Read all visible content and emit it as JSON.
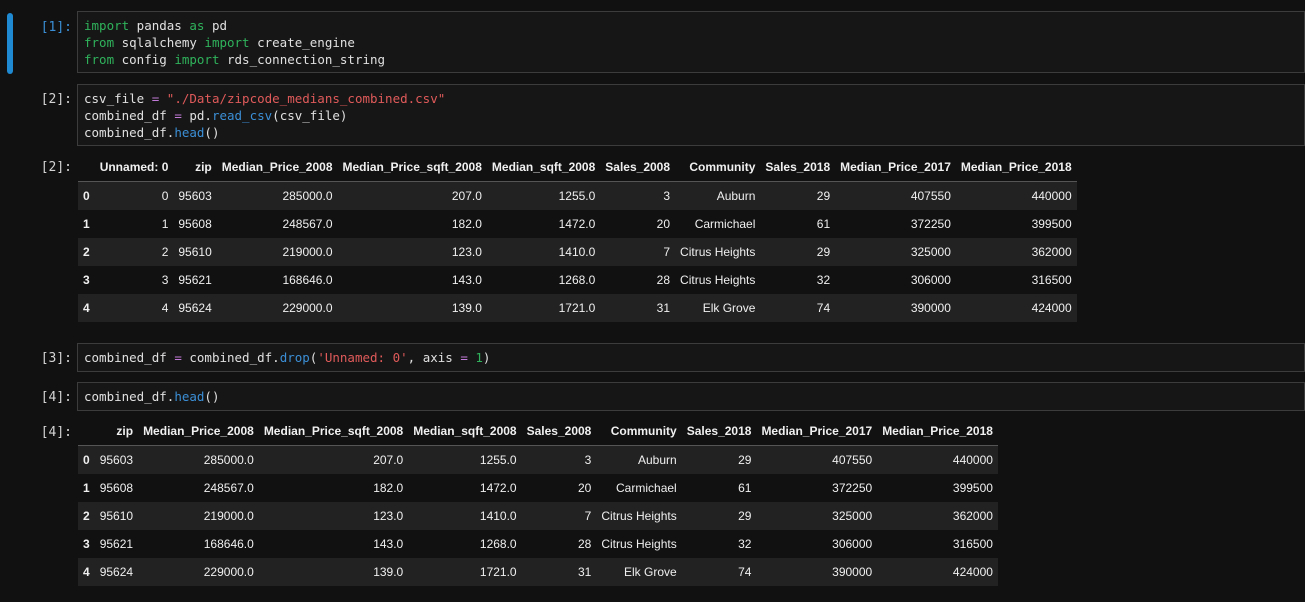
{
  "cells": [
    {
      "prompt": "[1]:",
      "lines": [
        [
          [
            "kw",
            "import"
          ],
          [
            "t",
            " pandas "
          ],
          [
            "kw",
            "as"
          ],
          [
            "t",
            " pd"
          ]
        ],
        [
          [
            "kw",
            "from"
          ],
          [
            "t",
            " sqlalchemy "
          ],
          [
            "kw",
            "import"
          ],
          [
            "t",
            " create_engine"
          ]
        ],
        [
          [
            "kw",
            "from"
          ],
          [
            "t",
            " config "
          ],
          [
            "kw",
            "import"
          ],
          [
            "t",
            " rds_connection_string"
          ]
        ]
      ]
    },
    {
      "prompt": "[2]:",
      "lines": [
        [
          [
            "t",
            "csv_file "
          ],
          [
            "op",
            "="
          ],
          [
            "t",
            " "
          ],
          [
            "str",
            "\"./Data/zipcode_medians_combined.csv\""
          ]
        ],
        [
          [
            "t",
            "combined_df "
          ],
          [
            "op",
            "="
          ],
          [
            "t",
            " pd."
          ],
          [
            "fn",
            "read_csv"
          ],
          [
            "t",
            "(csv_file)"
          ]
        ],
        [
          [
            "t",
            "combined_df."
          ],
          [
            "fn",
            "head"
          ],
          [
            "t",
            "()"
          ]
        ]
      ]
    },
    {
      "prompt": "[3]:",
      "lines": [
        [
          [
            "t",
            "combined_df "
          ],
          [
            "op",
            "="
          ],
          [
            "t",
            " combined_df."
          ],
          [
            "fn",
            "drop"
          ],
          [
            "t",
            "("
          ],
          [
            "str",
            "'Unnamed: 0'"
          ],
          [
            "t",
            ", axis "
          ],
          [
            "op",
            "="
          ],
          [
            "t",
            " "
          ],
          [
            "num",
            "1"
          ],
          [
            "t",
            ")"
          ]
        ]
      ]
    },
    {
      "prompt": "[4]:",
      "lines": [
        [
          [
            "t",
            "combined_df."
          ],
          [
            "fn",
            "head"
          ],
          [
            "t",
            "()"
          ]
        ]
      ]
    }
  ],
  "outputs": [
    {
      "prompt": "[2]:",
      "columns": [
        "",
        "Unnamed: 0",
        "zip",
        "Median_Price_2008",
        "Median_Price_sqft_2008",
        "Median_sqft_2008",
        "Sales_2008",
        "Community",
        "Sales_2018",
        "Median_Price_2017",
        "Median_Price_2018"
      ],
      "rows": [
        [
          "0",
          "0",
          "95603",
          "285000.0",
          "207.0",
          "1255.0",
          "3",
          "Auburn",
          "29",
          "407550",
          "440000"
        ],
        [
          "1",
          "1",
          "95608",
          "248567.0",
          "182.0",
          "1472.0",
          "20",
          "Carmichael",
          "61",
          "372250",
          "399500"
        ],
        [
          "2",
          "2",
          "95610",
          "219000.0",
          "123.0",
          "1410.0",
          "7",
          "Citrus Heights",
          "29",
          "325000",
          "362000"
        ],
        [
          "3",
          "3",
          "95621",
          "168646.0",
          "143.0",
          "1268.0",
          "28",
          "Citrus Heights",
          "32",
          "306000",
          "316500"
        ],
        [
          "4",
          "4",
          "95624",
          "229000.0",
          "139.0",
          "1721.0",
          "31",
          "Elk Grove",
          "74",
          "390000",
          "424000"
        ]
      ]
    },
    {
      "prompt": "[4]:",
      "columns": [
        "",
        "zip",
        "Median_Price_2008",
        "Median_Price_sqft_2008",
        "Median_sqft_2008",
        "Sales_2008",
        "Community",
        "Sales_2018",
        "Median_Price_2017",
        "Median_Price_2018"
      ],
      "rows": [
        [
          "0",
          "95603",
          "285000.0",
          "207.0",
          "1255.0",
          "3",
          "Auburn",
          "29",
          "407550",
          "440000"
        ],
        [
          "1",
          "95608",
          "248567.0",
          "182.0",
          "1472.0",
          "20",
          "Carmichael",
          "61",
          "372250",
          "399500"
        ],
        [
          "2",
          "95610",
          "219000.0",
          "123.0",
          "1410.0",
          "7",
          "Citrus Heights",
          "29",
          "325000",
          "362000"
        ],
        [
          "3",
          "95621",
          "168646.0",
          "143.0",
          "1268.0",
          "28",
          "Citrus Heights",
          "32",
          "306000",
          "316500"
        ],
        [
          "4",
          "95624",
          "229000.0",
          "139.0",
          "1721.0",
          "31",
          "Elk Grove",
          "74",
          "390000",
          "424000"
        ]
      ]
    }
  ]
}
